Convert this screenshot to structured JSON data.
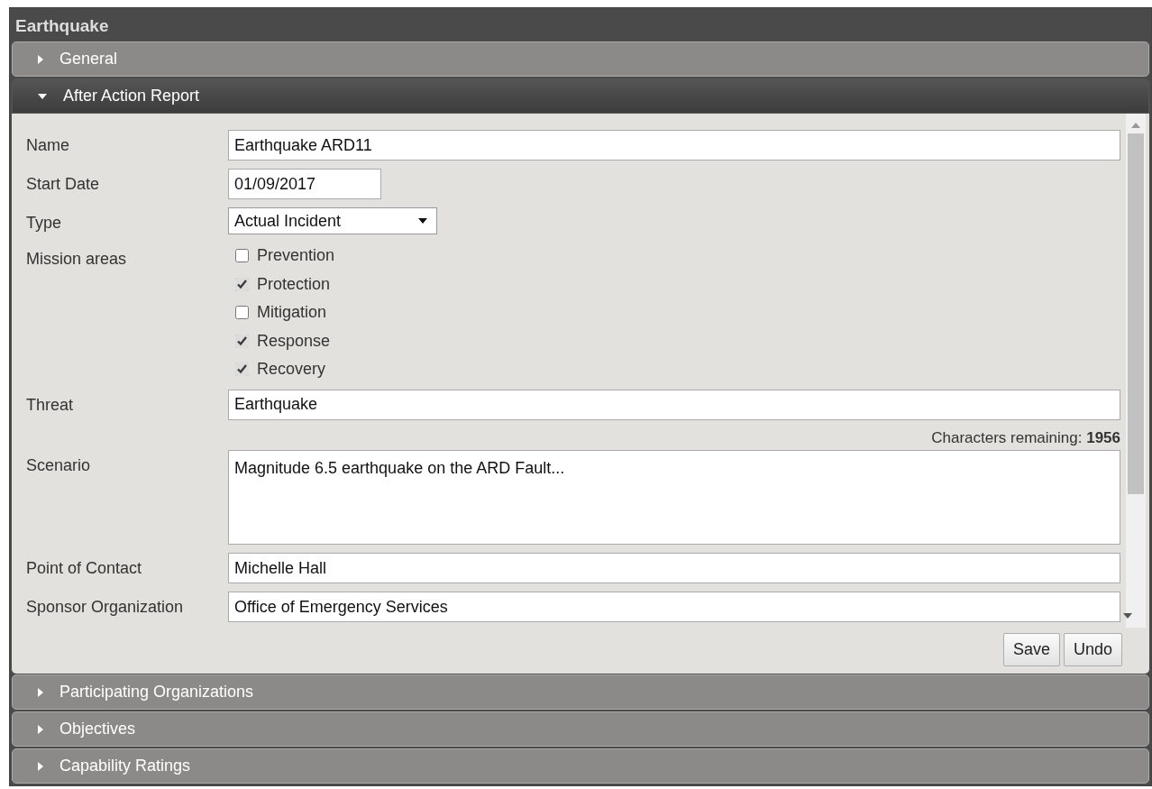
{
  "title": "Earthquake",
  "sections": [
    {
      "title": "General",
      "expanded": false
    },
    {
      "title": "After Action Report",
      "expanded": true,
      "form": [
        {
          "kind": "text",
          "label": "Name",
          "value": "Earthquake ARD11"
        },
        {
          "kind": "date",
          "label": "Start Date",
          "value": "01/09/2017"
        },
        {
          "kind": "select",
          "label": "Type",
          "value": "Actual Incident"
        },
        {
          "kind": "checkboxes",
          "label": "Mission areas",
          "options": [
            {
              "label": "Prevention",
              "checked": false
            },
            {
              "label": "Protection",
              "checked": true
            },
            {
              "label": "Mitigation",
              "checked": false
            },
            {
              "label": "Response",
              "checked": true
            },
            {
              "label": "Recovery",
              "checked": true
            }
          ]
        },
        {
          "kind": "text",
          "label": "Threat",
          "value": "Earthquake"
        },
        {
          "kind": "textarea",
          "label": "Scenario",
          "counter": "Characters remaining: **1956**",
          "value": "Magnitude 6.5 earthquake on the ARD Fault..."
        },
        {
          "kind": "text",
          "label": "Point of Contact",
          "value": "Michelle Hall"
        },
        {
          "kind": "text",
          "label": "Sponsor Organization",
          "value": "Office of Emergency Services"
        }
      ],
      "buttons": [
        "Save",
        "Undo"
      ]
    },
    {
      "title": "Participating Organizations",
      "expanded": false
    },
    {
      "title": "Objectives",
      "expanded": false
    },
    {
      "title": "Capability Ratings",
      "expanded": false
    }
  ]
}
